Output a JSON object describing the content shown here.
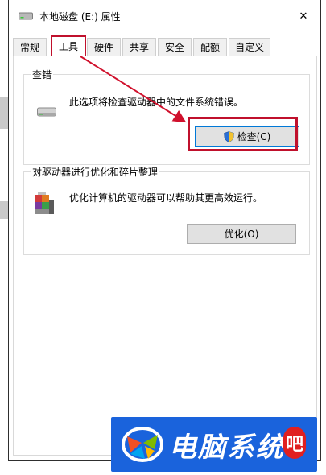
{
  "window": {
    "title": "本地磁盘 (E:) 属性",
    "close_glyph": "✕"
  },
  "tabs": [
    {
      "label": "常规",
      "active": false
    },
    {
      "label": "工具",
      "active": true
    },
    {
      "label": "硬件",
      "active": false
    },
    {
      "label": "共享",
      "active": false
    },
    {
      "label": "安全",
      "active": false
    },
    {
      "label": "配额",
      "active": false
    },
    {
      "label": "自定义",
      "active": false
    }
  ],
  "error_check": {
    "title": "查错",
    "description": "此选项将检查驱动器中的文件系统错误。",
    "button_label": "检查(C)",
    "icon": "drive-icon"
  },
  "optimize": {
    "title": "对驱动器进行优化和碎片整理",
    "description": "优化计算机的驱动器可以帮助其更高效运行。",
    "button_label": "优化(O)",
    "icon": "defrag-icon"
  },
  "watermark": {
    "text": "电脑系统",
    "badge_text": "吧"
  },
  "colors": {
    "highlight": "#c0102c",
    "watermark_bg": "#1a63dc",
    "focus_border": "#0078d7"
  }
}
